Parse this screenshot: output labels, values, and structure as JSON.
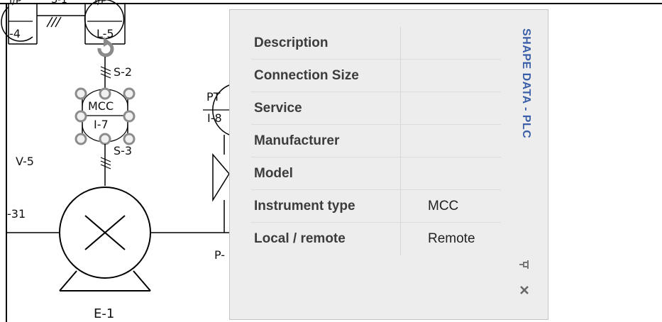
{
  "drawing": {
    "labels": {
      "ip_left": "I/P",
      "ip_right": "I/P",
      "tag_4": "-4",
      "tag_ls": "L-5",
      "s1": "S-1",
      "s2": "S-2",
      "mcc": "MCC",
      "i7": "I-7",
      "s3": "S-3",
      "v5": "V-5",
      "pt": "PT",
      "i8": "I-8",
      "tag_31": "-31",
      "p": "P-",
      "e1": "E-1"
    }
  },
  "shape_data_panel": {
    "title": "SHAPE DATA - PLC",
    "rows": [
      {
        "name": "Description",
        "value": ""
      },
      {
        "name": "Connection Size",
        "value": ""
      },
      {
        "name": "Service",
        "value": ""
      },
      {
        "name": "Manufacturer",
        "value": ""
      },
      {
        "name": "Model",
        "value": ""
      },
      {
        "name": "Instrument type",
        "value": "MCC"
      },
      {
        "name": "Local / remote",
        "value": "Remote"
      }
    ],
    "icons": {
      "pin": "pin-icon",
      "close": "close-icon"
    }
  }
}
